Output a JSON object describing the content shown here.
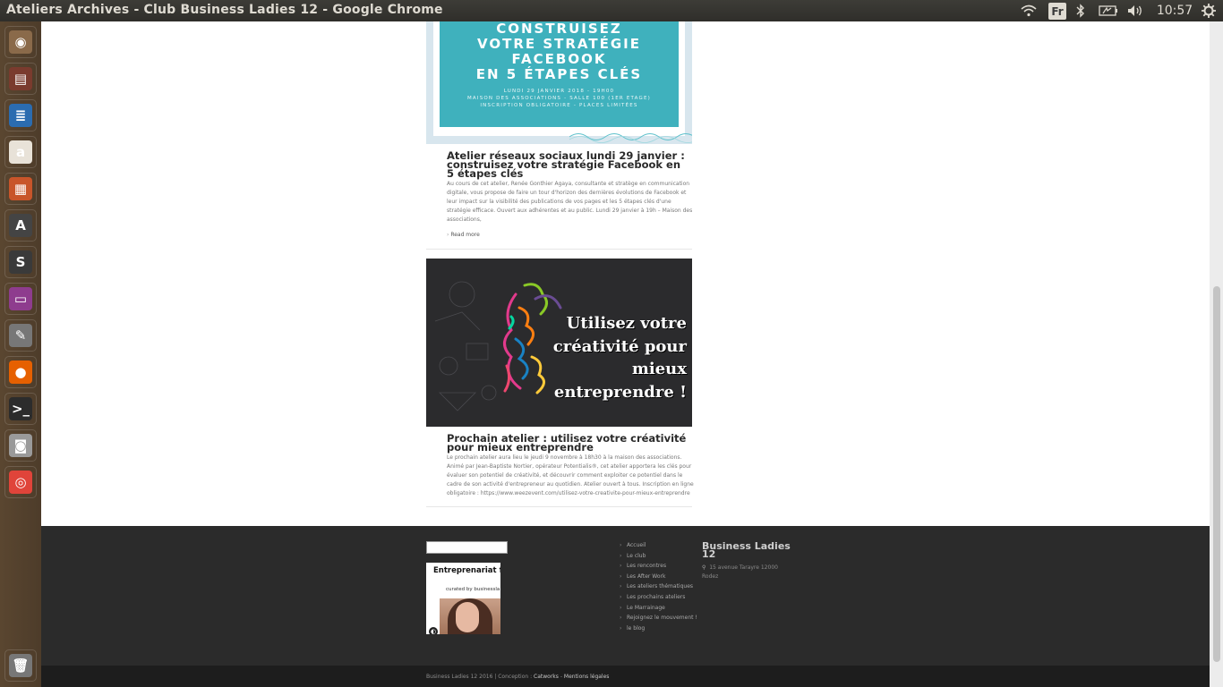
{
  "window": {
    "title": "Ateliers Archives - Club Business Ladies 12 - Google Chrome"
  },
  "tray": {
    "language": "Fr",
    "clock": "10:57"
  },
  "launcher": {
    "items": [
      {
        "name": "ubuntu-dash-icon",
        "glyph": "◉",
        "color": "#8a6a4a"
      },
      {
        "name": "files-icon",
        "glyph": "▤",
        "color": "#7a3b2e"
      },
      {
        "name": "libreoffice-writer-icon",
        "glyph": "≣",
        "color": "#2b6cb0"
      },
      {
        "name": "amazon-icon",
        "glyph": "a",
        "color": "#e8e2d8"
      },
      {
        "name": "libreoffice-impress-icon",
        "glyph": "▦",
        "color": "#c8552a"
      },
      {
        "name": "software-updater-icon",
        "glyph": "A",
        "color": "#444"
      },
      {
        "name": "sublime-text-icon",
        "glyph": "S",
        "color": "#3a3a3a"
      },
      {
        "name": "app-window-icon",
        "glyph": "▭",
        "color": "#8e3c8e"
      },
      {
        "name": "system-settings-icon",
        "glyph": "✎",
        "color": "#777"
      },
      {
        "name": "firefox-icon",
        "glyph": "●",
        "color": "#e66000"
      },
      {
        "name": "terminal-icon",
        "glyph": ">_",
        "color": "#2c2c2c"
      },
      {
        "name": "camera-icon",
        "glyph": "◙",
        "color": "#9a9a9a"
      },
      {
        "name": "chrome-icon",
        "glyph": "◎",
        "color": "#e0443a"
      }
    ],
    "trash": {
      "name": "trash-icon",
      "glyph": "🗑",
      "color": "#777"
    }
  },
  "posts": [
    {
      "image_lines": [
        "CONSTRUISEZ",
        "VOTRE STRATÉGIE",
        "FACEBOOK",
        "EN 5 ÉTAPES CLÉS"
      ],
      "image_small_lines": [
        "LUNDI 29 JANVIER 2018 - 19H00",
        "MAISON DES ASSOCIATIONS - SALLE 100 (1ER ETAGE)",
        "INSCRIPTION OBLIGATOIRE - PLACES LIMITÉES"
      ],
      "title": "Atelier réseaux sociaux lundi 29 janvier : construisez votre stratégie Facebook en 5 étapes clés",
      "excerpt": "Au cours de cet atelier, Renée Gonthier Agaya, consultante et stratège en communication digitale, vous propose de faire un tour d'horizon des dernières évolutions de Facebook et leur impact sur la visibilité des publications de vos pages et les 5 étapes clés d'une stratégie efficace. Ouvert aux adhérentes et au public. Lundi 29 janvier à 19h – Maison des associations,",
      "read_more": "Read more"
    },
    {
      "image_lines": [
        "Utilisez votre",
        "créativité pour",
        "mieux",
        "entreprendre !"
      ],
      "title": "Prochain atelier : utilisez votre créativité pour mieux entreprendre",
      "excerpt": "Le prochain atelier aura lieu le jeudi 9 novembre à 18h30 à la maison des associations. Animé par Jean-Baptiste Nortier, opérateur Potentialis®, cet atelier apportera les clés pour évaluer son potentiel de créativité, et découvrir comment exploiter ce potentiel dans le cadre de son activité d'entrepreneur au quotidien. Atelier ouvert à tous. Inscription en ligne obligatoire :  https://www.weezevent.com/utilisez-votre-creativite-pour-mieux-entreprendre"
    }
  ],
  "footer": {
    "widget_title": "Entreprenariat fér",
    "widget_subtitle": "curated by businessla",
    "menu": [
      "Accueil",
      "Le club",
      "Les rencontres",
      "Les After Work",
      "Les ateliers thématiques",
      "Les prochains ateliers",
      "Le Marrainage",
      "Rejoignez le mouvement !",
      "le blog"
    ],
    "brand": "Business Ladies 12",
    "address": "15 avenue Tarayre 12000 Rodez",
    "copyright": "Business Ladies 12  2016 | Conception : ",
    "catworks": "Catworks",
    "sep": " - ",
    "legal": "Mentions légales"
  }
}
